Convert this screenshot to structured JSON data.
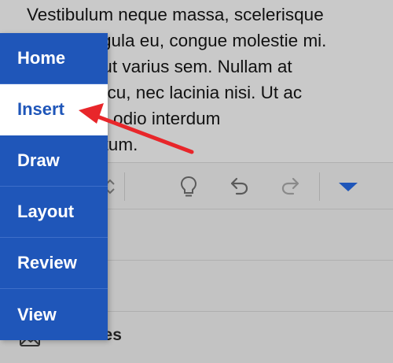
{
  "document": {
    "lines": [
      "Vestibulum neque massa, scelerisque",
      "sit amet ligula eu, congue molestie mi.",
      "Praesent ut varius sem. Nullam at",
      "porttitor arcu, nec lacinia nisi. Ut ac",
      "dolor vitae odio interdum",
      "condimentum."
    ]
  },
  "toolbar": {
    "icons": [
      "lightbulb-icon",
      "undo-icon",
      "redo-icon",
      "dropdown-triangle-icon"
    ]
  },
  "list": {
    "pictures_label": "Pictures"
  },
  "menu": {
    "items": [
      {
        "label": "Home"
      },
      {
        "label": "Insert"
      },
      {
        "label": "Draw"
      },
      {
        "label": "Layout"
      },
      {
        "label": "Review"
      },
      {
        "label": "View"
      }
    ],
    "active_index": 1
  },
  "colors": {
    "menu_background": "#1f56b9",
    "menu_active_background": "#ffffff",
    "annotation_arrow": "#e8262a",
    "accent_blue": "#1f56b9"
  }
}
